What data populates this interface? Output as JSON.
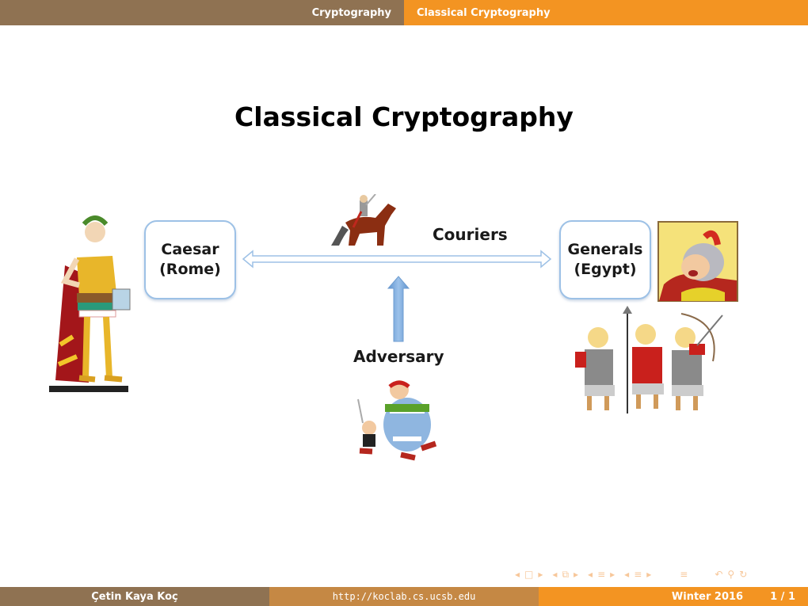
{
  "headline": {
    "section": "Cryptography",
    "subsection": "Classical Cryptography"
  },
  "slide": {
    "title": "Classical Cryptography",
    "diagram": {
      "sender_box": [
        "Caesar",
        "(Rome)"
      ],
      "receiver_box": [
        "Generals",
        "(Egypt)"
      ],
      "channel_label": "Couriers",
      "adversary_label": "Adversary",
      "images": [
        "caesar-figure",
        "horse-rider-courier",
        "centurion-portrait",
        "roman-soldiers",
        "asterix-obelix-adversary"
      ]
    }
  },
  "footer": {
    "author": "Çetin Kaya Koç",
    "url": "http://koclab.cs.ucsb.edu",
    "term": "Winter 2016",
    "page": "1 / 1"
  },
  "navigation": {
    "icons": [
      "nav-prev-icon",
      "frame-icon",
      "nav-next-icon",
      "nav-prev-icon",
      "slides-icon",
      "nav-next-icon",
      "nav-prev-icon",
      "section-icon",
      "nav-next-icon",
      "nav-prev-icon",
      "subsection-icon",
      "nav-next-icon",
      "align-icon",
      "undo-icon",
      "search-icon",
      "redo-icon"
    ]
  },
  "colors": {
    "brown": "#8f7252",
    "tan": "#c58844",
    "orange": "#f39422",
    "box_border": "#9dc1e6",
    "arrow_blue": "#7aa9da"
  }
}
